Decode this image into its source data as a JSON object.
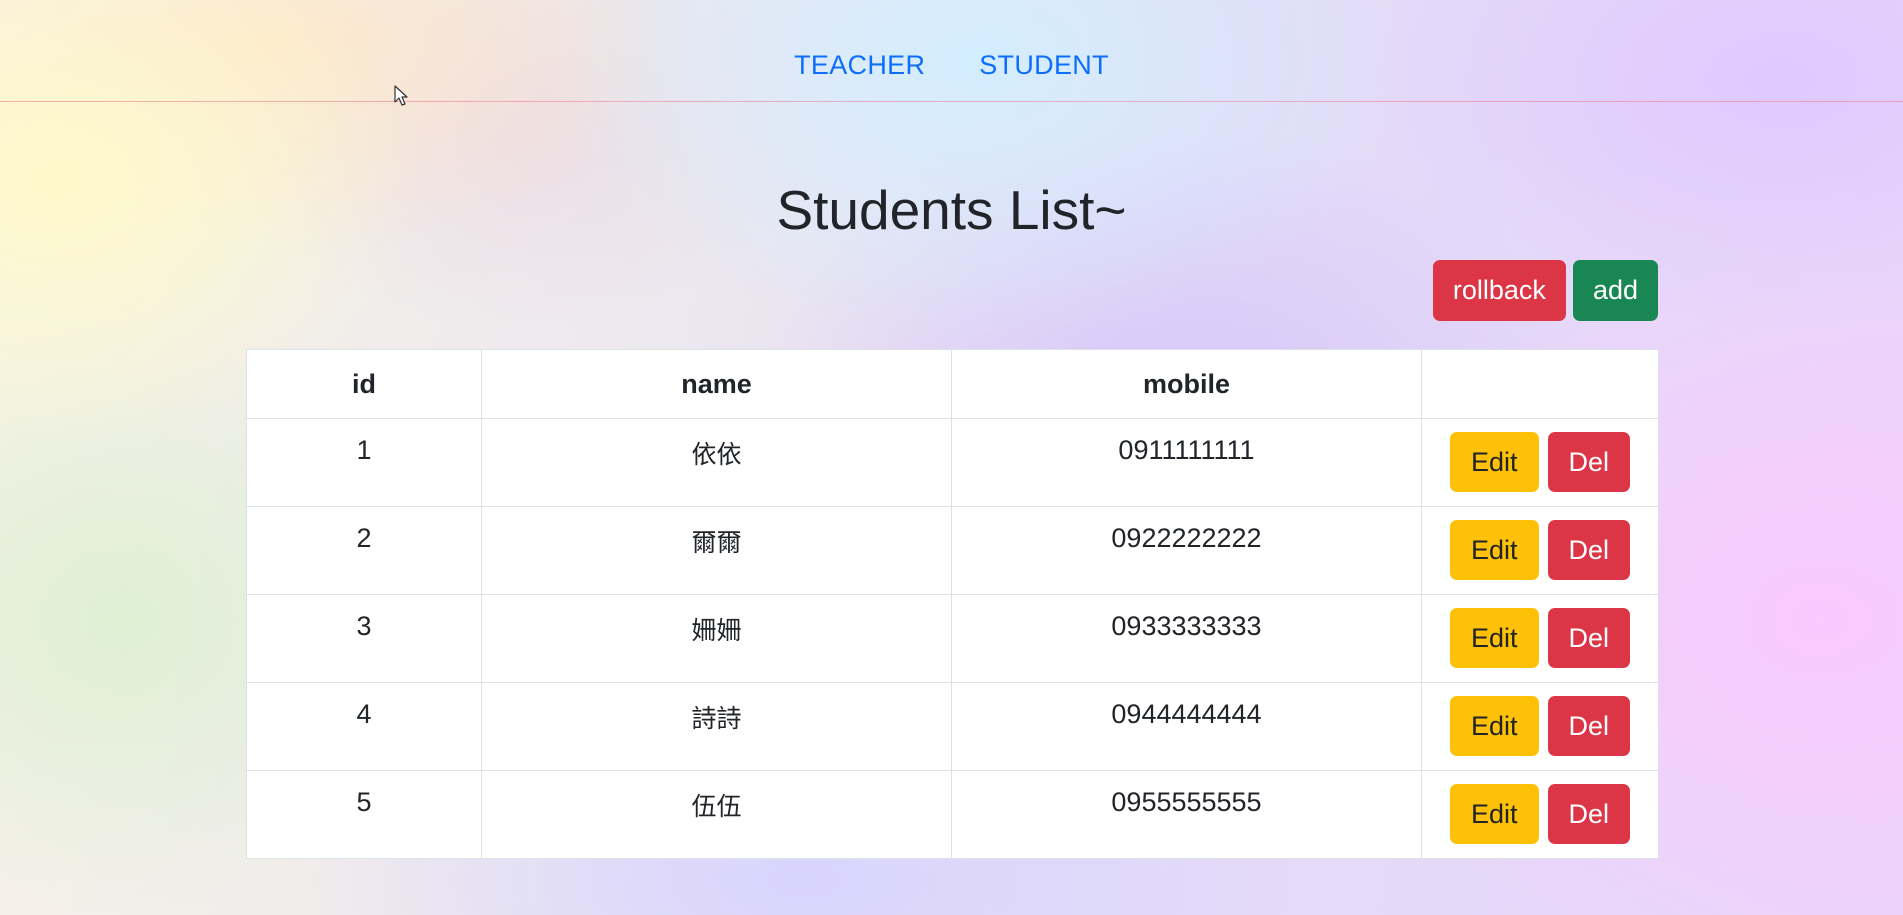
{
  "nav": {
    "links": [
      {
        "label": "TEACHER"
      },
      {
        "label": "STUDENT"
      }
    ]
  },
  "page": {
    "title": "Students List~"
  },
  "toolbar": {
    "rollback_label": "rollback",
    "add_label": "add"
  },
  "table": {
    "columns": [
      "id",
      "name",
      "mobile",
      ""
    ],
    "rows": [
      {
        "id": "1",
        "name": "依依",
        "mobile": "0911111111",
        "edit_label": "Edit",
        "del_label": "Del"
      },
      {
        "id": "2",
        "name": "爾爾",
        "mobile": "0922222222",
        "edit_label": "Edit",
        "del_label": "Del"
      },
      {
        "id": "3",
        "name": "姍姍",
        "mobile": "0933333333",
        "edit_label": "Edit",
        "del_label": "Del"
      },
      {
        "id": "4",
        "name": "詩詩",
        "mobile": "0944444444",
        "edit_label": "Edit",
        "del_label": "Del"
      },
      {
        "id": "5",
        "name": "伍伍",
        "mobile": "0955555555",
        "edit_label": "Edit",
        "del_label": "Del"
      }
    ]
  },
  "colors": {
    "link": "#0d6efd",
    "danger": "#dc3545",
    "success": "#198754",
    "warning": "#ffc107"
  },
  "icons": {
    "cursor": "mouse-pointer-icon"
  }
}
